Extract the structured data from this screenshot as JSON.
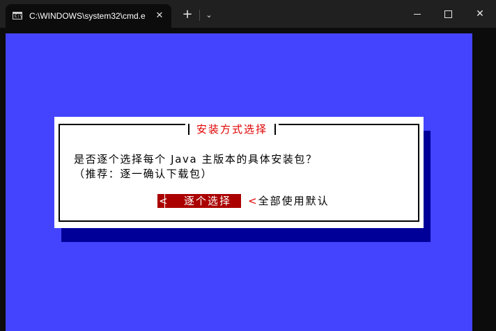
{
  "window": {
    "tab_title": "C:\\WINDOWS\\system32\\cmd.e",
    "tab_icon_text": "C:\\",
    "tab_close": "✕",
    "new_tab": "+",
    "dropdown": "⌄",
    "close_glyph": "✕"
  },
  "dialog": {
    "title": "安装方式选择",
    "line1": "是否逐个选择每个 Java 主版本的具体安装包？",
    "line2": "（推荐：逐一确认下载包）",
    "buttons": {
      "selected_bracket": "<",
      "selected_label": "逐个选择",
      "other_bracket": "<",
      "other_label": "全部使用默认"
    }
  },
  "colors": {
    "terminal_bg": "#4444ff",
    "dialog_bg": "#ffffff",
    "dialog_shadow": "#000099",
    "title_color": "#e00000",
    "selected_button_bg": "#aa0000"
  }
}
